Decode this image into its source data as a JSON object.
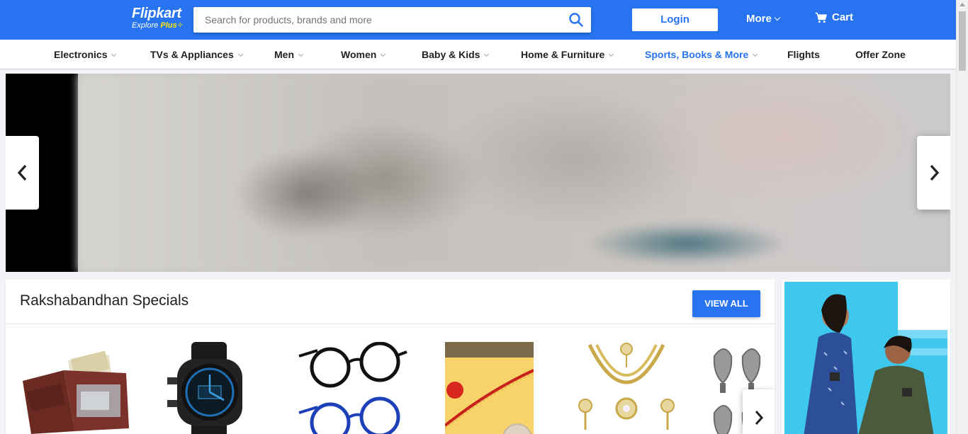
{
  "header": {
    "logo_text": "Flipkart",
    "logo_sub_text": "Explore",
    "logo_sub_plus": "Plus",
    "search_placeholder": "Search for products, brands and more",
    "login_label": "Login",
    "more_label": "More",
    "cart_label": "Cart",
    "brand_color": "#2874f0"
  },
  "categories": [
    {
      "label": "Electronics",
      "has_dropdown": true
    },
    {
      "label": "TVs & Appliances",
      "has_dropdown": true
    },
    {
      "label": "Men",
      "has_dropdown": true
    },
    {
      "label": "Women",
      "has_dropdown": true
    },
    {
      "label": "Baby & Kids",
      "has_dropdown": true
    },
    {
      "label": "Home & Furniture",
      "has_dropdown": true
    },
    {
      "label": "Sports, Books & More",
      "has_dropdown": true,
      "active": true
    },
    {
      "label": "Flights",
      "has_dropdown": false
    },
    {
      "label": "Offer Zone",
      "has_dropdown": false
    }
  ],
  "banner": {
    "prev_icon": "chevron-left-icon",
    "next_icon": "chevron-right-icon"
  },
  "deals": {
    "title": "Rakshabandhan Specials",
    "view_all_label": "VIEW ALL",
    "products": [
      {
        "name": "wallet"
      },
      {
        "name": "digital-watch"
      },
      {
        "name": "eyeglasses"
      },
      {
        "name": "rakhi-thali"
      },
      {
        "name": "necklace-set"
      },
      {
        "name": "earrings"
      }
    ]
  },
  "side_ad": {
    "subject": "promo-image"
  }
}
